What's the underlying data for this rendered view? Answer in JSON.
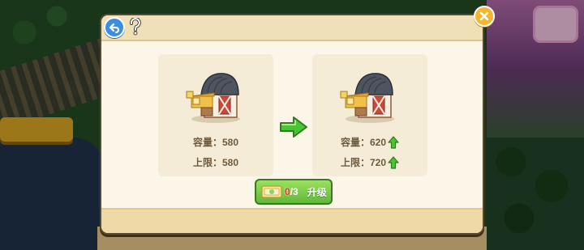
{
  "header": {
    "back_icon": "back-arrow-icon",
    "help_icon": "question-mark-icon",
    "close_icon": "close-x-icon"
  },
  "current": {
    "capacity_label": "容量：",
    "capacity_value": "580",
    "limit_label": "上限：",
    "limit_value": "580"
  },
  "next": {
    "capacity_label": "容量：",
    "capacity_value": "620",
    "limit_label": "上限：",
    "limit_value": "720"
  },
  "upgrade": {
    "have": "0",
    "need": "/3",
    "label": "升级"
  },
  "colors": {
    "accent_green": "#61b83a",
    "arrow_green": "#4cc335",
    "back_blue": "#3c8ee0",
    "close_orange": "#f7b52d",
    "count_red": "#e33b2c"
  }
}
